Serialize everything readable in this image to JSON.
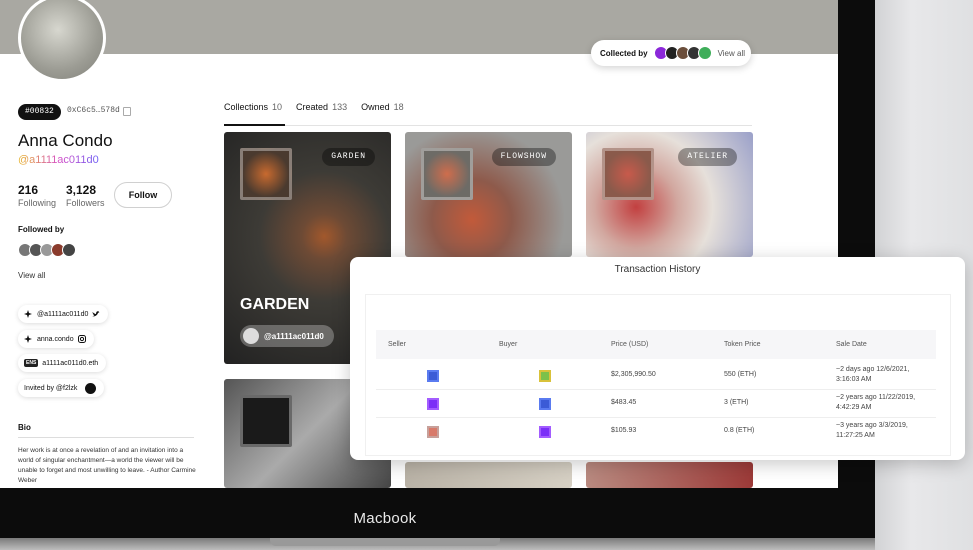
{
  "banner": {
    "collected_by_label": "Collected by",
    "view_all": "View all"
  },
  "profile": {
    "hash_badge": "#00832",
    "address": "0xC6c5…578d",
    "name": "Anna Condo",
    "handle": "@a1111ac011d0",
    "following_count": "216",
    "following_label": "Following",
    "followers_count": "3,128",
    "followers_label": "Followers",
    "follow_button": "Follow",
    "followed_by_label": "Followed by",
    "view_all": "View all"
  },
  "socials": [
    {
      "text": "@a1111ac011d0",
      "icon": "twitter-icon"
    },
    {
      "text": "anna.condo",
      "icon": "instagram-icon"
    },
    {
      "text": "a1111ac011d0.eth",
      "badge": "ENS"
    },
    {
      "text": "Invited by @f2lzk",
      "icon": "avatar"
    }
  ],
  "bio": {
    "heading": "Bio",
    "text": "Her work is at once a revelation of and an invitation into a world of singular enchantment—a world the viewer will be unable to forget and most unwilling to leave. - Author Carmine Weber"
  },
  "tabs": [
    {
      "label": "Collections",
      "count": "10"
    },
    {
      "label": "Created",
      "count": "133"
    },
    {
      "label": "Owned",
      "count": "18"
    }
  ],
  "cards": [
    {
      "tag": "GARDEN",
      "title": "GARDEN",
      "owner": "@a1111ac011d0"
    },
    {
      "tag": "FLOWSHOW"
    },
    {
      "tag": "ATELIER"
    }
  ],
  "transactions": {
    "title": "Transaction History",
    "columns": [
      "Seller",
      "Buyer",
      "Price (USD)",
      "Token Price",
      "Sale Date"
    ],
    "rows": [
      {
        "price_usd": "$2,305,990.50",
        "token_price": "550 (ETH)",
        "date_1": "~2 days ago 12/6/2021,",
        "date_2": "3:16:03 AM"
      },
      {
        "price_usd": "$483.45",
        "token_price": "3 (ETH)",
        "date_1": "~2 years ago 11/22/2019,",
        "date_2": "4:42:29 AM"
      },
      {
        "price_usd": "$105.93",
        "token_price": "0.8 (ETH)",
        "date_1": "~3 years ago 3/3/2019,",
        "date_2": "11:27:25 AM"
      }
    ]
  },
  "device": {
    "label": "Macbook"
  },
  "colors": {
    "banner": "#a9a8a2",
    "dark": "#111111",
    "accent_purple": "#7b2ff7"
  }
}
